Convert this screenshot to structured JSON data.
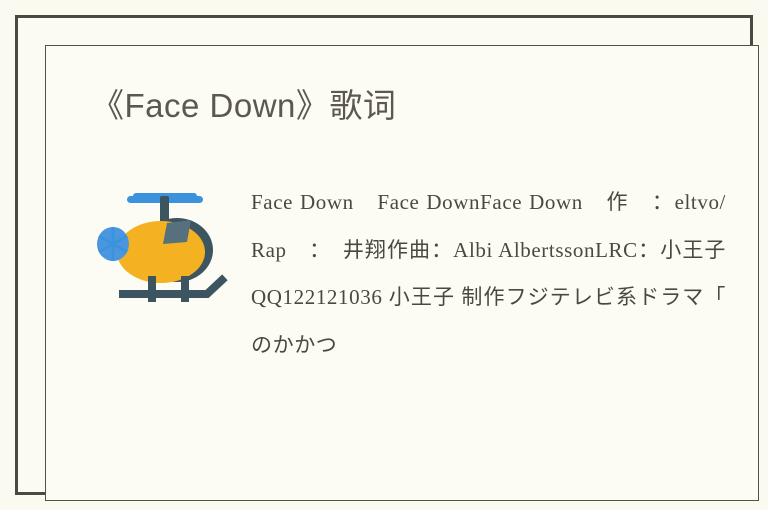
{
  "page": {
    "background_color": "#fbfaf1",
    "frame_color": "#4c4a3f",
    "inner_frame_color": "#55533f"
  },
  "header": {
    "title": "《Face Down》歌词",
    "title_color": "#5c584f"
  },
  "article": {
    "thumbnail": {
      "icon_name": "helicopter-icon",
      "emoji": "🚁",
      "colors": {
        "body": "#f4b223",
        "cabin": "#3d5561",
        "rotor": "#3b93dd",
        "window": "#56707d",
        "skid": "#3d5561",
        "nose_hub": "#4a97e0"
      }
    },
    "lyrics_text": "Face Down　Face DownFace Down　作　：eltvo/Rap　：　井翔作曲：Albi AlbertssonLRC：小王子QQ122121036 小王子 制作フジテレビ系ドラマ「　のかかつ",
    "lyrics_color": "#4b483f",
    "lines": [
      "Face Down　Face DownFace Dow",
      "n　作　：eltvo/Rap　：　井翔",
      "作曲：Albi AlbertssonLRC：小",
      "王子QQ122121036 小王子 制作フ",
      "ジテレビ系ドラマ「　のかかつ"
    ]
  }
}
